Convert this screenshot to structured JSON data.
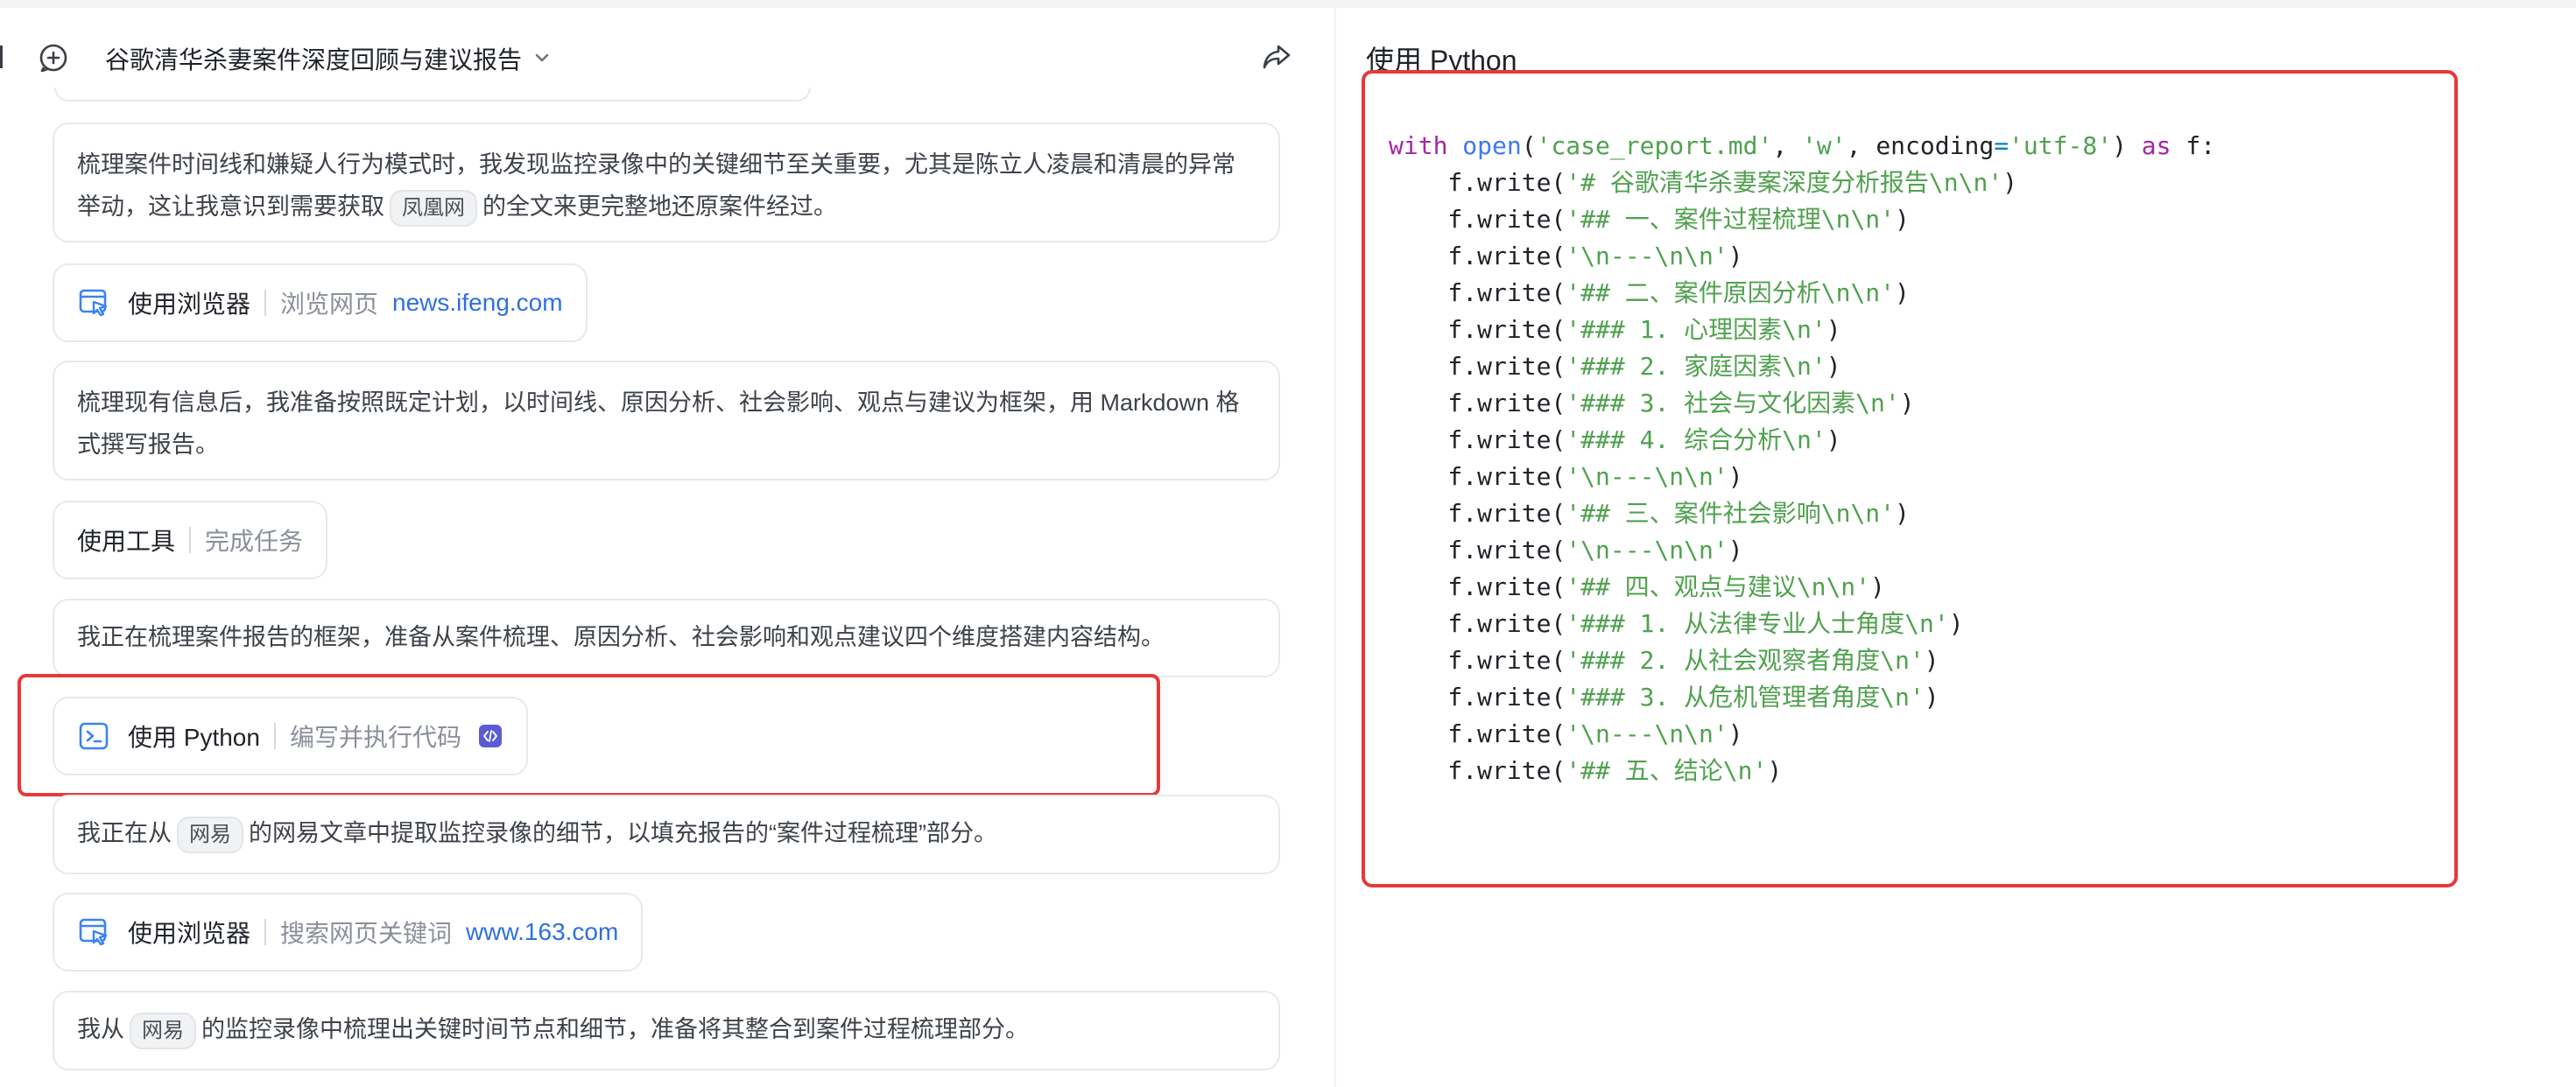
{
  "header": {
    "title": "谷歌清华杀妻案件深度回顾与建议报告"
  },
  "messages": [
    {
      "before": "梳理案件时间线和嫌疑人行为模式时，我发现监控录像中的关键细节至关重要，尤其是陈立人凌晨和清晨的异常举动，这让我意识到需要获取",
      "chip": "凤凰网",
      "after": "的全文来更完整地还原案件经过。"
    },
    {
      "text": "梳理现有信息后，我准备按照既定计划，以时间线、原因分析、社会影响、观点与建议为框架，用 Markdown 格式撰写报告。"
    },
    {
      "text": "我正在梳理案件报告的框架，准备从案件梳理、原因分析、社会影响和观点建议四个维度搭建内容结构。"
    },
    {
      "before": "我正在从",
      "chip": "网易",
      "after": "的网易文章中提取监控录像的细节，以填充报告的“案件过程梳理”部分。"
    },
    {
      "before": "我从",
      "chip": "网易",
      "after": "的监控录像中梳理出关键时间节点和细节，准备将其整合到案件过程梳理部分。"
    }
  ],
  "tools": [
    {
      "name": "使用浏览器",
      "action": "浏览网页",
      "link": "news.ifeng.com",
      "icon": "browser-icon"
    },
    {
      "name": "使用工具",
      "action": "完成任务"
    },
    {
      "name": "使用 Python",
      "action": "编写并执行代码",
      "icon": "terminal-icon",
      "badge": "code-badge-icon"
    },
    {
      "name": "使用浏览器",
      "action": "搜索网页关键词",
      "link": "www.163.com",
      "icon": "browser-icon"
    }
  ],
  "right_panel": {
    "title": "使用 Python",
    "code": {
      "open_line": {
        "kw1": "with",
        "fn": "open",
        "arg1": "'case_report.md'",
        "arg2": "'w'",
        "kwarg": "encoding",
        "eq": "=",
        "arg3": "'utf-8'",
        "kw2": "as",
        "var": "f:"
      },
      "writes": [
        "'# 谷歌清华杀妻案深度分析报告\\n\\n'",
        "'## 一、案件过程梳理\\n\\n'",
        "'\\n---\\n\\n'",
        "'## 二、案件原因分析\\n\\n'",
        "'### 1. 心理因素\\n'",
        "'### 2. 家庭因素\\n'",
        "'### 3. 社会与文化因素\\n'",
        "'### 4. 综合分析\\n'",
        "'\\n---\\n\\n'",
        "'## 三、案件社会影响\\n\\n'",
        "'\\n---\\n\\n'",
        "'## 四、观点与建议\\n\\n'",
        "'### 1. 从法律专业人士角度\\n'",
        "'### 2. 从社会观察者角度\\n'",
        "'### 3. 从危机管理者角度\\n'",
        "'\\n---\\n\\n'",
        "'## 五、结论\\n'"
      ],
      "write_prefix": "    f.write(",
      "write_suffix": ")"
    }
  },
  "colors": {
    "highlight_border": "#e5393a",
    "link": "#2f6fe0",
    "code_string": "#50a14f",
    "code_keyword": "#a626a4",
    "code_function": "#4078f2"
  }
}
